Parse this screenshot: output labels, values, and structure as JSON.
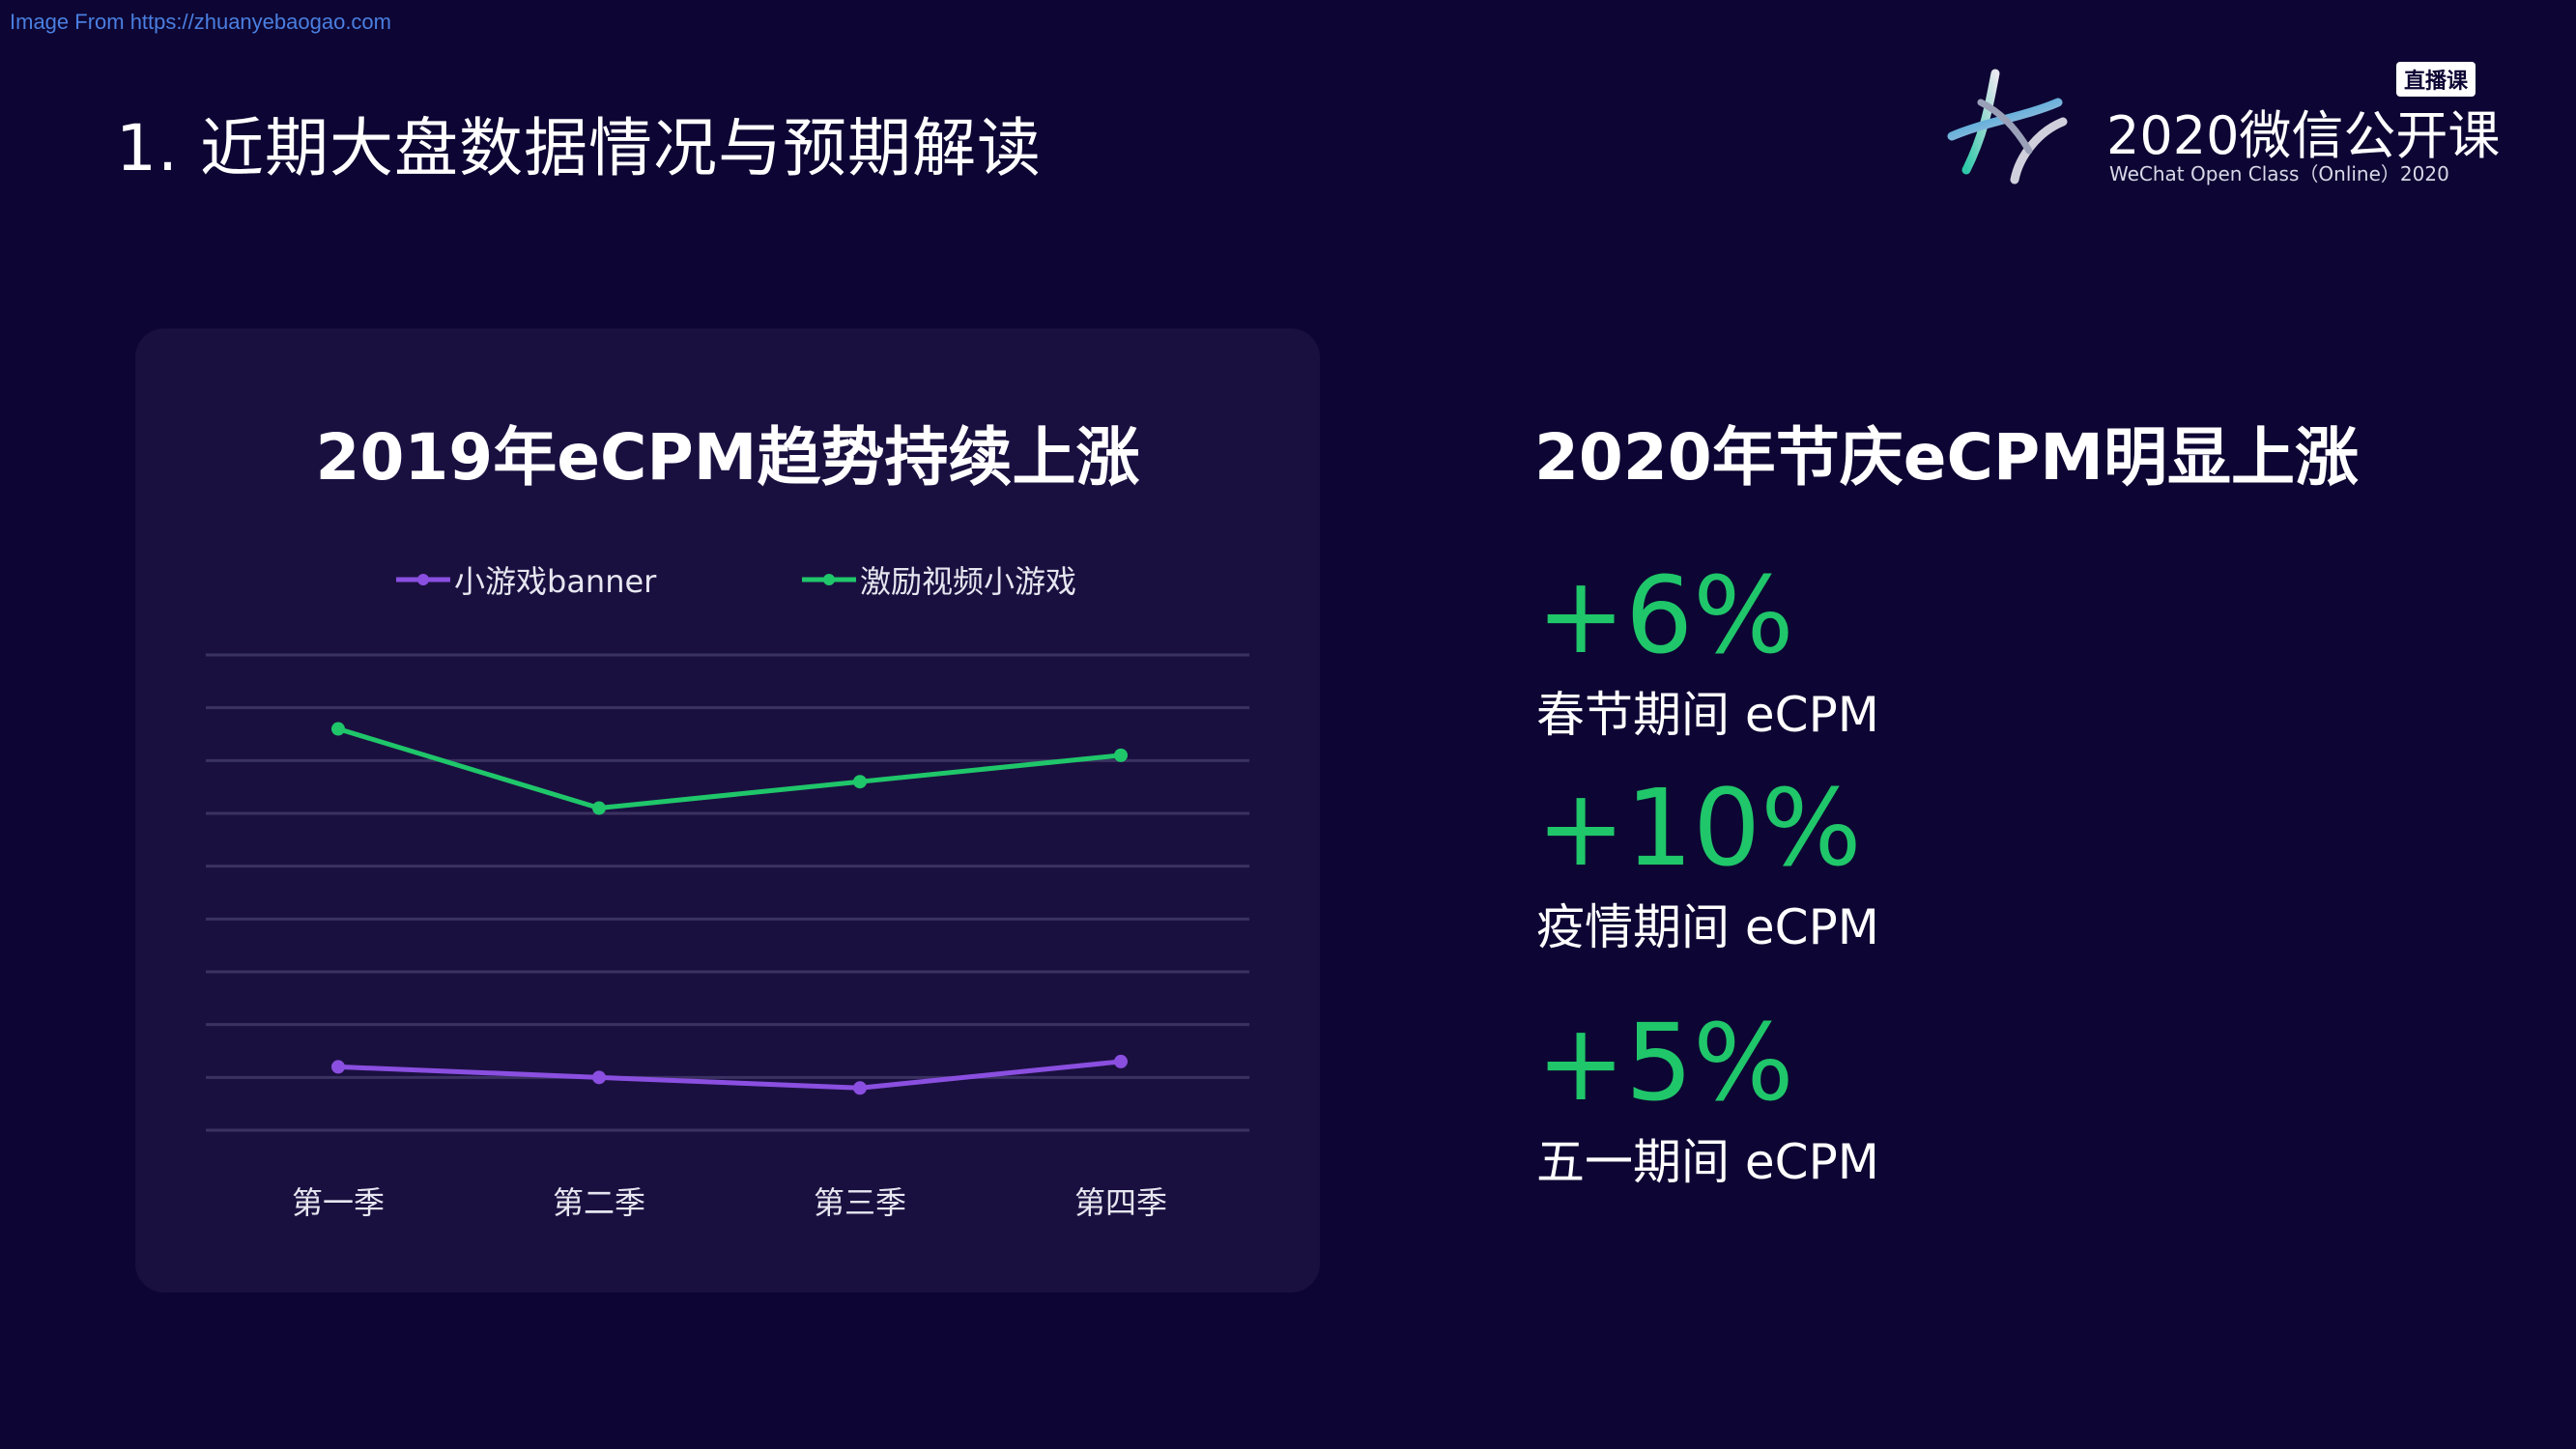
{
  "watermark": "Image From https://zhuanyebaogao.com",
  "page_title": "1. 近期大盘数据情况与预期解读",
  "logo": {
    "badge": "直播课",
    "title": "2020微信公开课",
    "subtitle": "WeChat Open Class（Online）2020"
  },
  "colors": {
    "background": "#0d0533",
    "card": "#1a1040",
    "green": "#1fc66a",
    "purple": "#8a4fe0"
  },
  "chart_data": {
    "type": "line",
    "title": "2019年eCPM趋势持续上涨",
    "categories": [
      "第一季",
      "第二季",
      "第三季",
      "第四季"
    ],
    "series": [
      {
        "name": "小游戏banner",
        "color": "#8a4fe0",
        "values": [
          1.2,
          1.0,
          0.8,
          1.3
        ]
      },
      {
        "name": "激励视频小游戏",
        "color": "#1fc66a",
        "values": [
          7.6,
          6.1,
          6.6,
          7.1
        ]
      }
    ],
    "ylim": [
      0,
      9
    ],
    "grid": true,
    "legend_position": "top",
    "xlabel": "",
    "ylabel": ""
  },
  "right_panel": {
    "title": "2020年节庆eCPM明显上涨",
    "stats": [
      {
        "value": "+6%",
        "label": "春节期间 eCPM"
      },
      {
        "value": "+10%",
        "label": "疫情期间 eCPM"
      },
      {
        "value": "+5%",
        "label": "五一期间 eCPM"
      }
    ]
  }
}
